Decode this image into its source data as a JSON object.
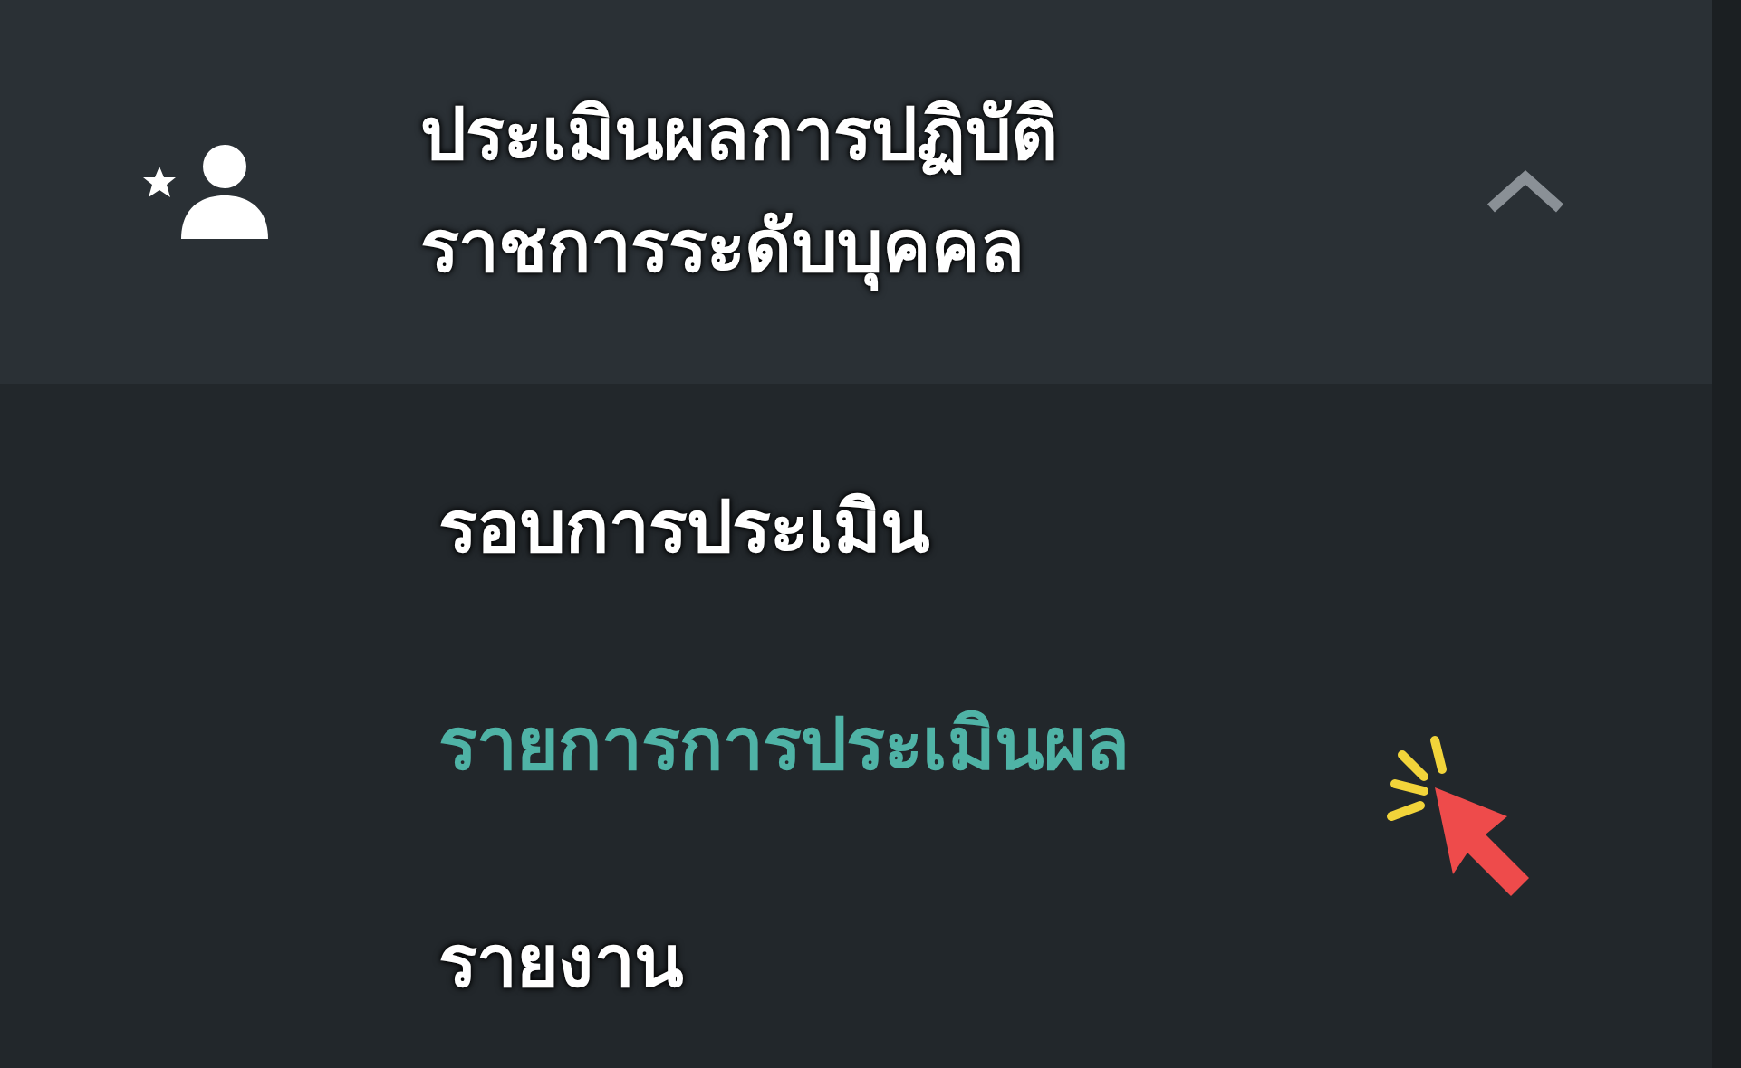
{
  "menu_group": {
    "title_lines": [
      "ประเมินผลการปฏิบัติ",
      "ราชการระดับบุคคล"
    ],
    "expanded": true,
    "items": [
      {
        "label": "รอบการประเมิน",
        "selected": false
      },
      {
        "label": "รายการการประเมินผล",
        "selected": true
      },
      {
        "label": "รายงาน",
        "selected": false
      }
    ]
  }
}
